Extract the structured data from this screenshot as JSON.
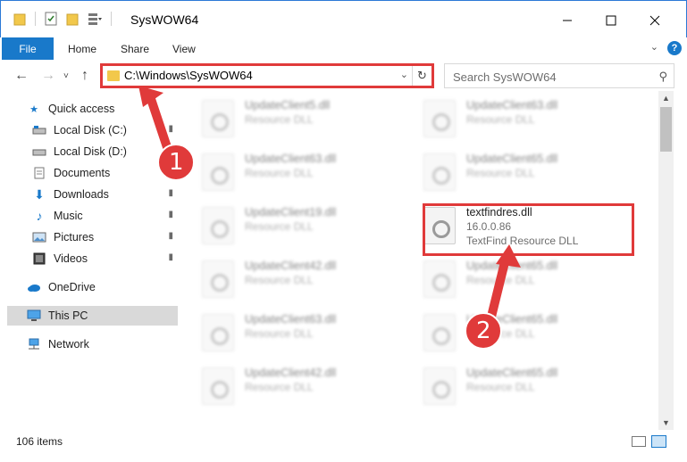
{
  "window": {
    "title": "SysWOW64"
  },
  "ribbon": {
    "tabs": [
      "File",
      "Home",
      "Share",
      "View"
    ],
    "help_label": "?"
  },
  "nav": {
    "address": "C:\\Windows\\SysWOW64",
    "search_placeholder": "Search SysWOW64"
  },
  "sidebar": {
    "items": [
      {
        "label": "Quick access",
        "icon": "star-icon"
      },
      {
        "label": "Local Disk (C:)",
        "icon": "drive-icon",
        "pinned": true
      },
      {
        "label": "Local Disk (D:)",
        "icon": "drive-icon"
      },
      {
        "label": "Documents",
        "icon": "documents-icon"
      },
      {
        "label": "Downloads",
        "icon": "download-icon",
        "pinned": true
      },
      {
        "label": "Music",
        "icon": "music-icon",
        "pinned": true
      },
      {
        "label": "Pictures",
        "icon": "pictures-icon",
        "pinned": true
      },
      {
        "label": "Videos",
        "icon": "videos-icon",
        "pinned": true
      },
      {
        "label": "OneDrive",
        "icon": "cloud-icon"
      },
      {
        "label": "This PC",
        "icon": "computer-icon",
        "selected": true
      },
      {
        "label": "Network",
        "icon": "network-icon"
      }
    ]
  },
  "files": [
    {
      "name": "UpdateClient5.dll",
      "type": "Resource DLL"
    },
    {
      "name": "UpdateClient63.dll",
      "type": "Resource DLL"
    },
    {
      "name": "UpdateClient63.dll",
      "type": "Resource DLL"
    },
    {
      "name": "UpdateClient65.dll",
      "type": "Resource DLL"
    },
    {
      "name": "UpdateClient19.dll",
      "type": "Resource DLL"
    },
    {
      "name": "textfindres.dll",
      "version": "16.0.0.86",
      "type": "TextFind Resource DLL"
    },
    {
      "name": "UpdateClient42.dll",
      "type": "Resource DLL"
    },
    {
      "name": "UpdateClient65.dll",
      "type": "Resource DLL"
    },
    {
      "name": "UpdateClient63.dll",
      "type": "Resource DLL"
    },
    {
      "name": "UpdateClient65.dll",
      "type": "Resource DLL"
    },
    {
      "name": "UpdateClient42.dll",
      "type": "Resource DLL"
    },
    {
      "name": "UpdateClient65.dll",
      "type": "Resource DLL"
    }
  ],
  "status": {
    "item_count": "106 items"
  },
  "annotations": {
    "step1": "1",
    "step2": "2",
    "color": "#e03a3a"
  }
}
